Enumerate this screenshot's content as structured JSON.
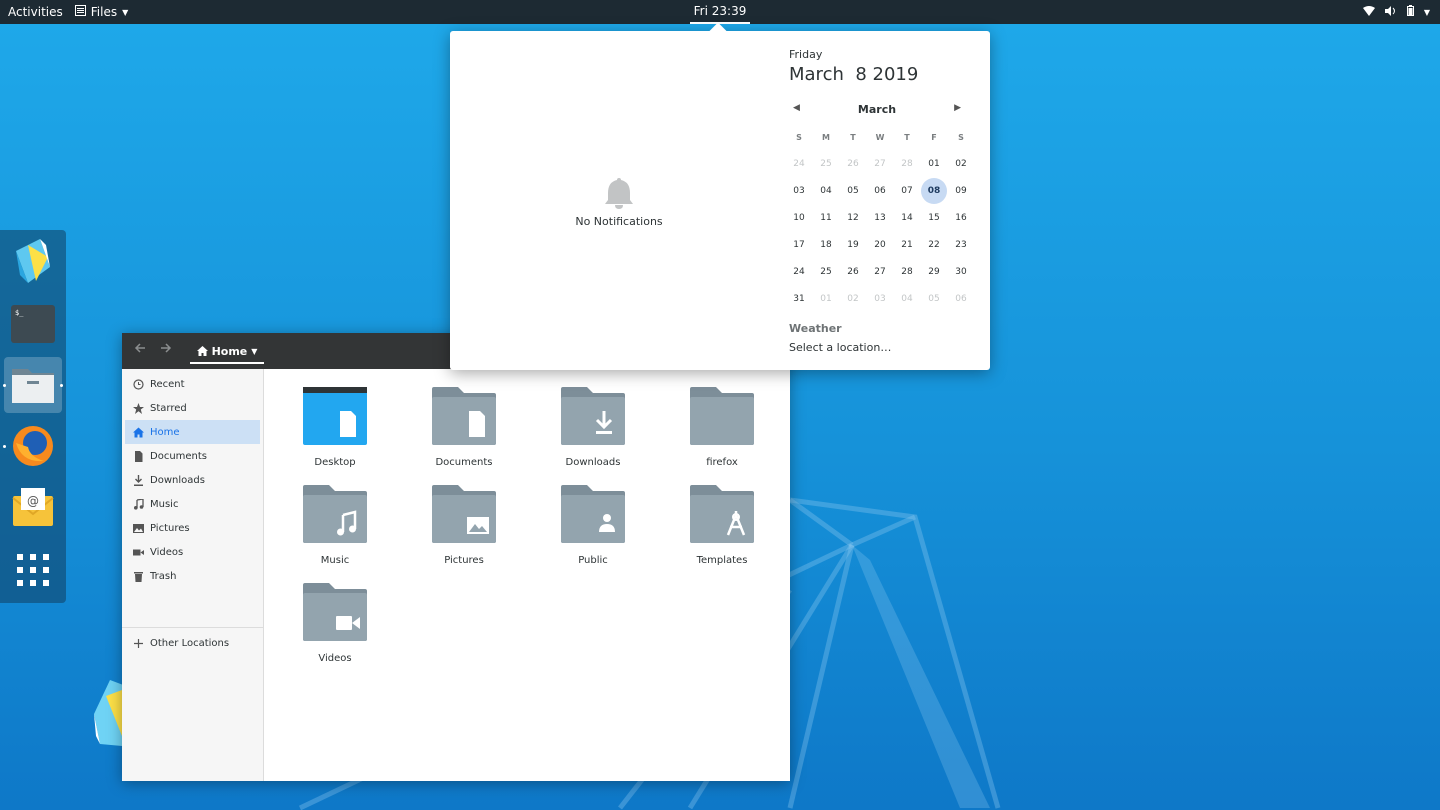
{
  "topbar": {
    "activities": "Activities",
    "app_name": "Files",
    "clock": "Fri 23:39"
  },
  "dock": {
    "items": [
      {
        "name": "Kali Linux"
      },
      {
        "name": "Terminal"
      },
      {
        "name": "Files"
      },
      {
        "name": "Firefox"
      },
      {
        "name": "Mail"
      },
      {
        "name": "Show Applications"
      }
    ]
  },
  "files": {
    "path_label": "Home",
    "sidebar": [
      {
        "label": "Recent"
      },
      {
        "label": "Starred"
      },
      {
        "label": "Home"
      },
      {
        "label": "Documents"
      },
      {
        "label": "Downloads"
      },
      {
        "label": "Music"
      },
      {
        "label": "Pictures"
      },
      {
        "label": "Videos"
      },
      {
        "label": "Trash"
      }
    ],
    "other_locations": "Other Locations",
    "folders": [
      {
        "label": "Desktop",
        "icon": "desktop-folder-icon"
      },
      {
        "label": "Documents",
        "icon": "documents-folder-icon"
      },
      {
        "label": "Downloads",
        "icon": "downloads-folder-icon"
      },
      {
        "label": "firefox",
        "icon": "folder-icon"
      },
      {
        "label": "Music",
        "icon": "music-folder-icon"
      },
      {
        "label": "Pictures",
        "icon": "pictures-folder-icon"
      },
      {
        "label": "Public",
        "icon": "public-folder-icon"
      },
      {
        "label": "Templates",
        "icon": "templates-folder-icon"
      },
      {
        "label": "Videos",
        "icon": "videos-folder-icon"
      }
    ]
  },
  "calendar": {
    "no_notifications": "No Notifications",
    "day_name": "Friday",
    "full_date": "March  8 2019",
    "month": "March",
    "weekdays": [
      "S",
      "M",
      "T",
      "W",
      "T",
      "F",
      "S"
    ],
    "weeks": [
      [
        "24",
        "25",
        "26",
        "27",
        "28",
        "01",
        "02"
      ],
      [
        "03",
        "04",
        "05",
        "06",
        "07",
        "08",
        "09"
      ],
      [
        "10",
        "11",
        "12",
        "13",
        "14",
        "15",
        "16"
      ],
      [
        "17",
        "18",
        "19",
        "20",
        "21",
        "22",
        "23"
      ],
      [
        "24",
        "25",
        "26",
        "27",
        "28",
        "29",
        "30"
      ],
      [
        "31",
        "01",
        "02",
        "03",
        "04",
        "05",
        "06"
      ]
    ],
    "dim_cells": [
      [
        0,
        0
      ],
      [
        0,
        1
      ],
      [
        0,
        2
      ],
      [
        0,
        3
      ],
      [
        0,
        4
      ],
      [
        5,
        1
      ],
      [
        5,
        2
      ],
      [
        5,
        3
      ],
      [
        5,
        4
      ],
      [
        5,
        5
      ],
      [
        5,
        6
      ]
    ],
    "today_cell": [
      1,
      5
    ],
    "weather_title": "Weather",
    "weather_location": "Select a location…"
  }
}
